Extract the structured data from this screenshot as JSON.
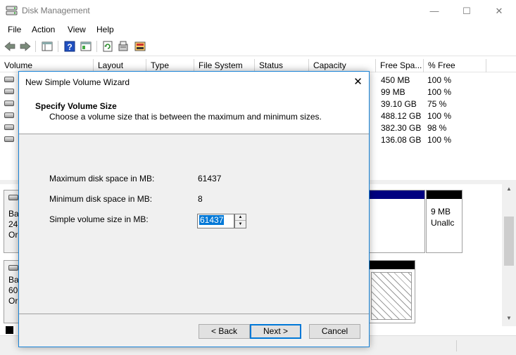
{
  "window": {
    "title": "Disk Management",
    "minimize": "—",
    "maximize": "☐",
    "close": "✕"
  },
  "menu": {
    "file": "File",
    "action": "Action",
    "view": "View",
    "help": "Help"
  },
  "columns": [
    "Volume",
    "Layout",
    "Type",
    "File System",
    "Status",
    "Capacity",
    "Free Spa...",
    "% Free"
  ],
  "volumes": [
    {
      "free": "450 MB",
      "pct": "100 %"
    },
    {
      "free": "99 MB",
      "pct": "100 %"
    },
    {
      "free": "39.10 GB",
      "pct": "75 %"
    },
    {
      "free": "488.12 GB",
      "pct": "100 %"
    },
    {
      "free": "382.30 GB",
      "pct": "98 %"
    },
    {
      "free": "136.08 GB",
      "pct": "100 %"
    }
  ],
  "disks": [
    {
      "line1": "Ba",
      "line2": "24(",
      "line3": "Or"
    },
    {
      "line1": "Ba",
      "line2": "60.",
      "line3": "Or"
    }
  ],
  "unallocated": {
    "size": "9 MB",
    "label": "Unallc"
  },
  "dialog": {
    "title": "New Simple Volume Wizard",
    "close": "✕",
    "heading": "Specify Volume Size",
    "subheading": "Choose a volume size that is between the maximum and minimum sizes.",
    "max_label": "Maximum disk space in MB:",
    "max_value": "61437",
    "min_label": "Minimum disk space in MB:",
    "min_value": "8",
    "size_label": "Simple volume size in MB:",
    "size_value": "61437",
    "back": "< Back",
    "next": "Next >",
    "cancel": "Cancel"
  },
  "colors": {
    "accent": "#0078d7",
    "primary_partition": "#000080",
    "unallocated": "#000000"
  }
}
